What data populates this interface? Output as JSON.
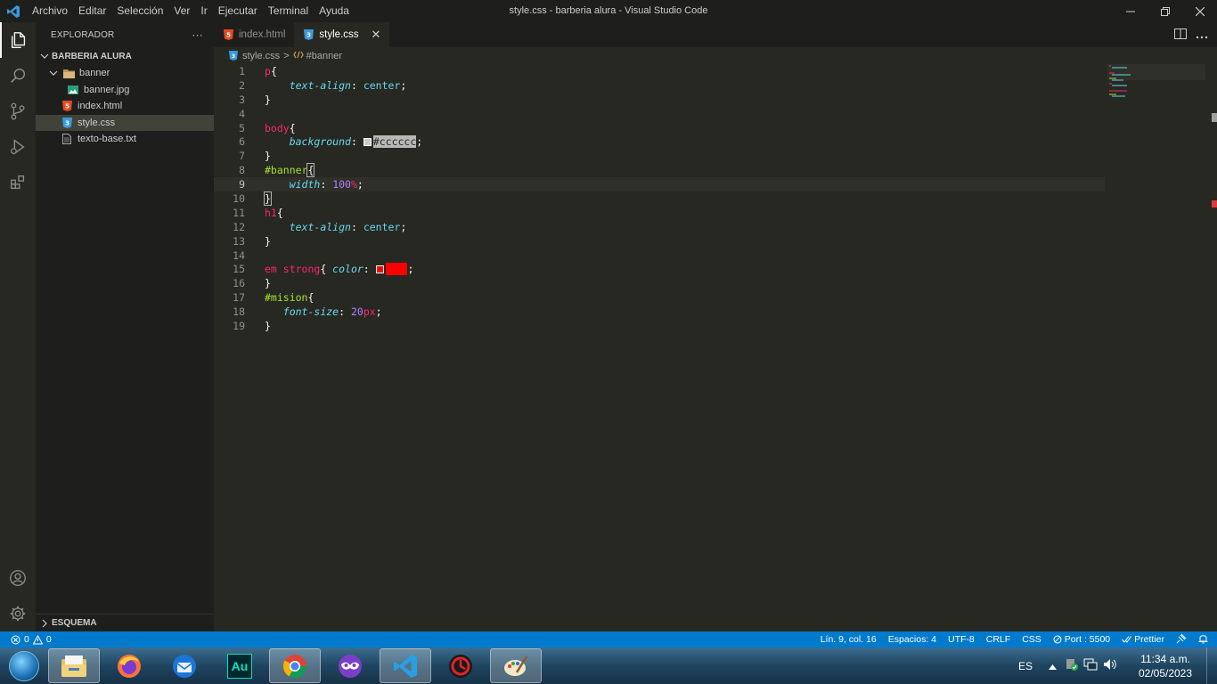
{
  "window": {
    "title": "style.css - barberia alura - Visual Studio Code",
    "menu": [
      "Archivo",
      "Editar",
      "Selección",
      "Ver",
      "Ir",
      "Ejecutar",
      "Terminal",
      "Ayuda"
    ]
  },
  "sidebar": {
    "header": "EXPLORADOR",
    "more": "···",
    "section": "BARBERIA ALURA",
    "items": [
      {
        "label": "banner",
        "icon": "folder-icon"
      },
      {
        "label": "banner.jpg",
        "icon": "image-icon"
      },
      {
        "label": "index.html",
        "icon": "html-icon"
      },
      {
        "label": "style.css",
        "icon": "css-icon"
      },
      {
        "label": "texto-base.txt",
        "icon": "text-file-icon"
      }
    ],
    "schema": "ESQUEMA"
  },
  "tabs": [
    {
      "label": "index.html",
      "icon": "html-icon"
    },
    {
      "label": "style.css",
      "icon": "css-icon",
      "close": "✕"
    }
  ],
  "breadcrumb": {
    "file": "style.css",
    "sep": ">",
    "symbol": "#banner"
  },
  "code": {
    "line_numbers": [
      "1",
      "2",
      "3",
      "4",
      "5",
      "6",
      "7",
      "8",
      "9",
      "10",
      "11",
      "12",
      "13",
      "14",
      "15",
      "16",
      "17",
      "18",
      "19"
    ],
    "current_line": 9,
    "tokens": {
      "l1_sel": "p",
      "l1_brace": "{",
      "l2_prop": "text-align",
      "l2_colon": ": ",
      "l2_val": "center",
      "l2_semi": ";",
      "close": "}",
      "l5_sel": "body",
      "l5_brace": "{",
      "l6_prop": "background",
      "l6_colon": ": ",
      "l6_val": "#cccccc",
      "l6_semi": ";",
      "l8_sel": "#banner",
      "l8_brace": "{",
      "l9_prop": "width",
      "l9_colon": ": ",
      "l9_num": "100",
      "l9_unit": "%",
      "l9_semi": ";",
      "l11_sel": "h1",
      "l11_brace": "{",
      "l12_prop": "text-align",
      "l12_colon": ": ",
      "l12_val": "center",
      "l12_semi": ";",
      "l15_sel": "em strong",
      "l15_brace": "{ ",
      "l15_prop": "color",
      "l15_colon": ": ",
      "l15_val": "red",
      "l15_semi": ";",
      "l17_sel": "#mision",
      "l17_brace": "{",
      "l18_prop": "font-size",
      "l18_colon": ": ",
      "l18_num": "20",
      "l18_unit": "px",
      "l18_semi": ";"
    }
  },
  "status": {
    "errors": "0",
    "warnings": "0",
    "position": "Lín. 9, col. 16",
    "spaces": "Espacios: 4",
    "encoding": "UTF-8",
    "eol": "CRLF",
    "language": "CSS",
    "port": "Port : 5500",
    "prettier": "Prettier"
  },
  "taskbar": {
    "apps": [
      "file-explorer-icon",
      "firefox-icon",
      "thunderbird-icon",
      "audition-icon",
      "chrome-icon",
      "mask-app-icon",
      "vscode-icon",
      "red-app-icon",
      "paint-icon"
    ],
    "audition_label": "Au",
    "lang": "ES",
    "time": "11:34 a.m.",
    "date": "02/05/2023"
  },
  "colors": {
    "status_bar": "#007acc",
    "editor_bg": "#272822",
    "keyword": "#f92672",
    "id_selector": "#a6e22e",
    "property": "#66d9ef",
    "number": "#ae81ff"
  }
}
